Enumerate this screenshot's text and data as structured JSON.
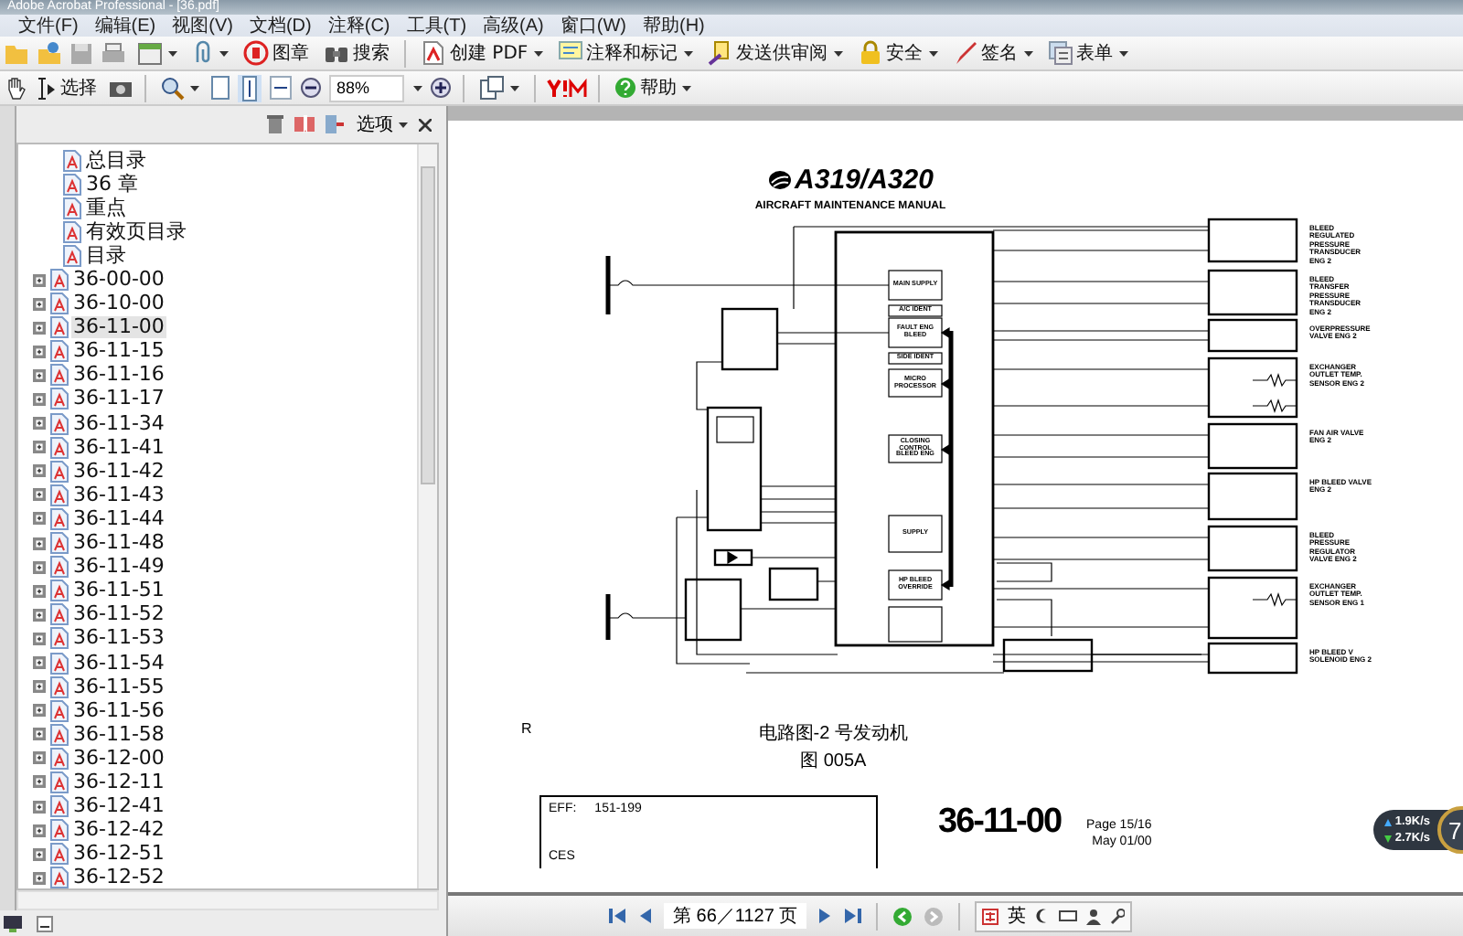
{
  "window": {
    "title": "Adobe Acrobat Professional - [36.pdf]"
  },
  "menu": [
    "文件(F)",
    "编辑(E)",
    "视图(V)",
    "文档(D)",
    "注释(C)",
    "工具(T)",
    "高级(A)",
    "窗口(W)",
    "帮助(H)"
  ],
  "toolbar_1": [
    {
      "label": "图章",
      "dropdown": false
    },
    {
      "label": "搜索",
      "dropdown": false
    },
    {
      "label": "创建 PDF",
      "dropdown": true
    },
    {
      "label": "注释和标记",
      "dropdown": true
    },
    {
      "label": "发送供审阅",
      "dropdown": true
    },
    {
      "label": "安全",
      "dropdown": true
    },
    {
      "label": "签名",
      "dropdown": true
    },
    {
      "label": "表单",
      "dropdown": true
    }
  ],
  "toolbar_2": {
    "select_label": "选择",
    "zoom": "88%",
    "help_label": "帮助"
  },
  "sidebar": {
    "options_label": "选项",
    "items": [
      {
        "label": "总目录",
        "expandable": false,
        "selected": false
      },
      {
        "label": "36 章",
        "expandable": false,
        "selected": false
      },
      {
        "label": "重点",
        "expandable": false,
        "selected": false
      },
      {
        "label": "有效页目录",
        "expandable": false,
        "selected": false
      },
      {
        "label": "目录",
        "expandable": false,
        "selected": false
      },
      {
        "label": "36-00-00",
        "expandable": true,
        "selected": false
      },
      {
        "label": "36-10-00",
        "expandable": true,
        "selected": false
      },
      {
        "label": "36-11-00",
        "expandable": true,
        "selected": true
      },
      {
        "label": "36-11-15",
        "expandable": true,
        "selected": false
      },
      {
        "label": "36-11-16",
        "expandable": true,
        "selected": false
      },
      {
        "label": "36-11-17",
        "expandable": true,
        "selected": false
      },
      {
        "label": "36-11-34",
        "expandable": true,
        "selected": false
      },
      {
        "label": "36-11-41",
        "expandable": true,
        "selected": false
      },
      {
        "label": "36-11-42",
        "expandable": true,
        "selected": false
      },
      {
        "label": "36-11-43",
        "expandable": true,
        "selected": false
      },
      {
        "label": "36-11-44",
        "expandable": true,
        "selected": false
      },
      {
        "label": "36-11-48",
        "expandable": true,
        "selected": false
      },
      {
        "label": "36-11-49",
        "expandable": true,
        "selected": false
      },
      {
        "label": "36-11-51",
        "expandable": true,
        "selected": false
      },
      {
        "label": "36-11-52",
        "expandable": true,
        "selected": false
      },
      {
        "label": "36-11-53",
        "expandable": true,
        "selected": false
      },
      {
        "label": "36-11-54",
        "expandable": true,
        "selected": false
      },
      {
        "label": "36-11-55",
        "expandable": true,
        "selected": false
      },
      {
        "label": "36-11-56",
        "expandable": true,
        "selected": false
      },
      {
        "label": "36-11-58",
        "expandable": true,
        "selected": false
      },
      {
        "label": "36-12-00",
        "expandable": true,
        "selected": false
      },
      {
        "label": "36-12-11",
        "expandable": true,
        "selected": false
      },
      {
        "label": "36-12-41",
        "expandable": true,
        "selected": false
      },
      {
        "label": "36-12-42",
        "expandable": true,
        "selected": false
      },
      {
        "label": "36-12-51",
        "expandable": true,
        "selected": false
      },
      {
        "label": "36-12-52",
        "expandable": true,
        "selected": false
      }
    ]
  },
  "page": {
    "logo_text": "A319/A320",
    "subtitle": "AIRCRAFT MAINTENANCE MANUAL",
    "diagram": {
      "blocks": [
        "MAIN SUPPLY",
        "A/C IDENT",
        "FAULT ENG BLEED",
        "SIDE IDENT",
        "MICRO PROCESSOR",
        "CLOSING CONTROL BLEED ENG",
        "SUPPLY",
        "HP BLEED OVERRIDE"
      ],
      "devices": [
        "BLEED REGULATED PRESSURE TRANSDUCER ENG 2",
        "BLEED TRANSFER PRESSURE TRANSDUCER ENG 2",
        "OVERPRESSURE VALVE ENG 2",
        "EXCHANGER OUTLET TEMP. SENSOR ENG 2",
        "FAN AIR VALVE ENG 2",
        "HP BLEED VALVE ENG 2",
        "BLEED PRESSURE REGULATOR VALVE ENG 2",
        "EXCHANGER OUTLET TEMP. SENSOR ENG 1",
        "HP BLEED V SOLENOID ENG 2"
      ]
    },
    "revision_mark": "R",
    "caption": "电路图-2 号发动机",
    "figure": "图 005A",
    "eff_label": "EFF:",
    "eff_value": "151-199",
    "ces": "CES",
    "chapter": "36-11-00",
    "page_number": "Page 15/16",
    "date": "May 01/00"
  },
  "navigation": {
    "page_field": "第 66／1127 页"
  },
  "ime_bar": {
    "language": "英"
  },
  "network_widget": {
    "upload": "1.9K/s",
    "download": "2.7K/s",
    "value": "7"
  }
}
